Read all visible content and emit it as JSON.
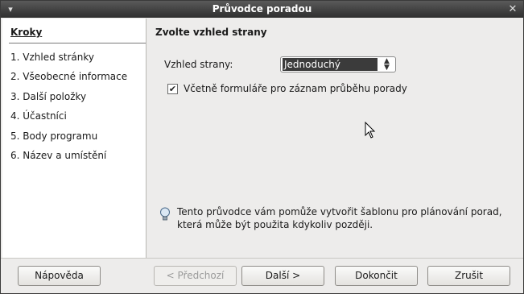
{
  "window": {
    "title": "Průvodce poradou"
  },
  "sidebar": {
    "heading": "Kroky",
    "steps": [
      "1. Vzhled stránky",
      "2. Všeobecné informace",
      "3. Další položky",
      "4. Účastníci",
      "5. Body programu",
      "6. Název a umístění"
    ]
  },
  "main": {
    "title": "Zvolte vzhled strany",
    "field_label": "Vzhled strany:",
    "field_value": "Jednoduchý",
    "checkbox_label": "Včetně formuláře pro záznam průběhu porady",
    "checkbox_checked": true,
    "info_line1": "Tento průvodce vám pomůže vytvořit šablonu pro plánování porad,",
    "info_line2": "která může být použita kdykoliv později."
  },
  "buttons": {
    "help": "Nápověda",
    "previous": "< Předchozí",
    "next": "Další >",
    "finish": "Dokončit",
    "cancel": "Zrušit"
  },
  "icons": {
    "window_menu": "window-menu-icon",
    "close": "close-icon",
    "info": "lightbulb-icon",
    "spin": "up-down-arrows-icon",
    "cursor": "mouse-pointer-icon"
  }
}
